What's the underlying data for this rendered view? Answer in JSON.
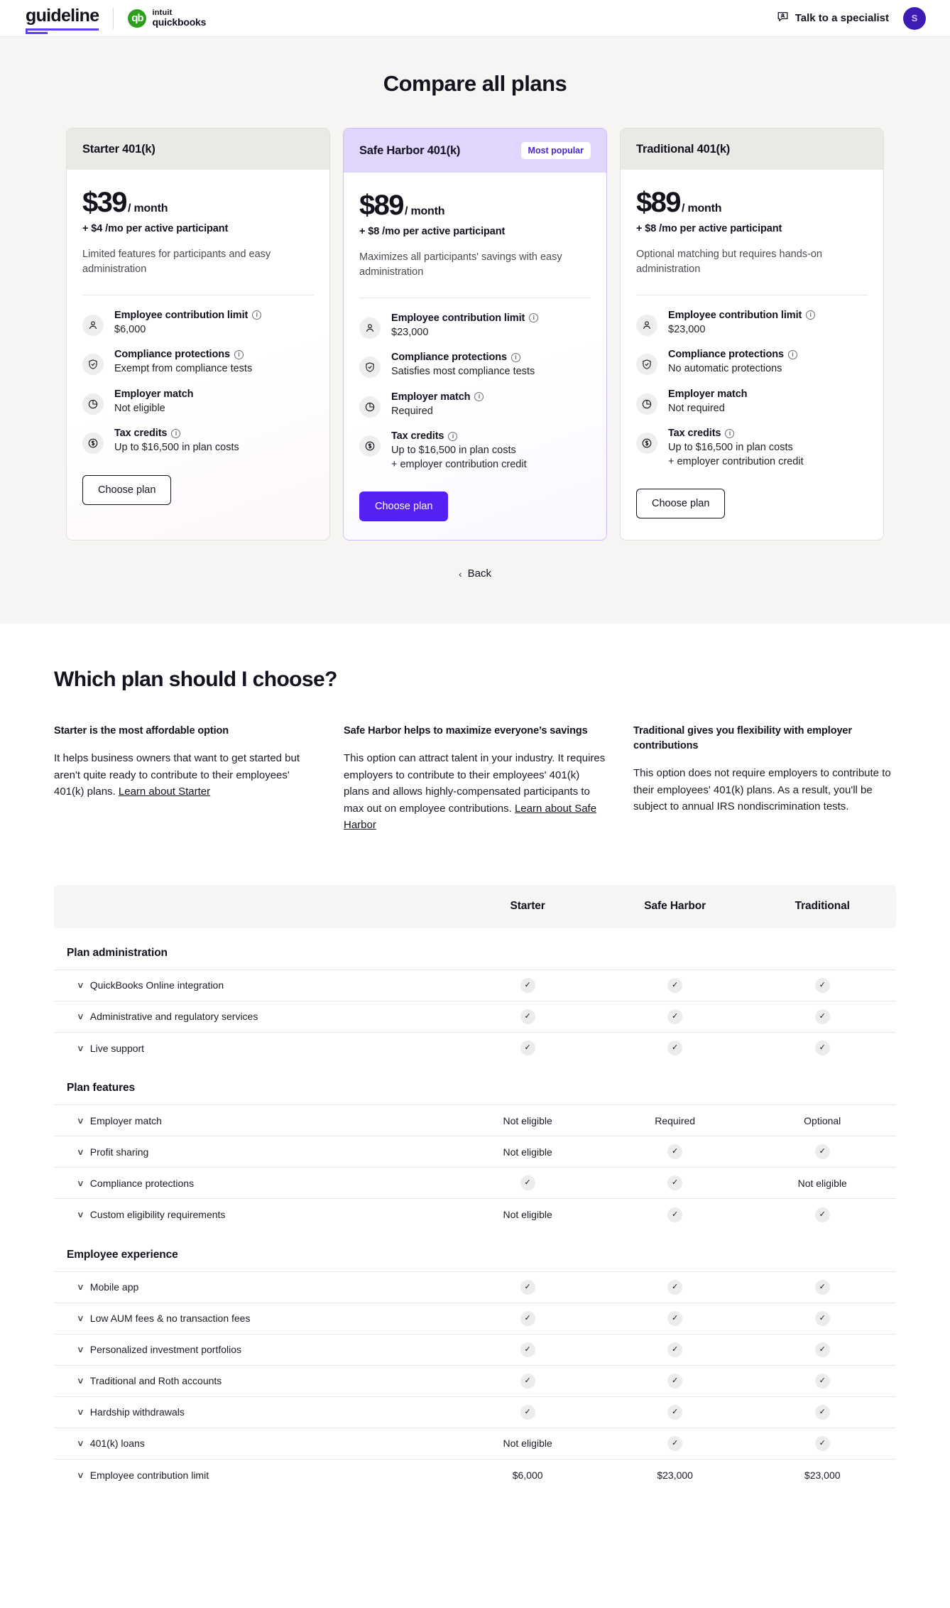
{
  "header": {
    "brand_guideline": "guideline",
    "brand_intuit": "intuit",
    "brand_quickbooks": "quickbooks",
    "qb_mark": "qb",
    "specialist_label": "Talk to a specialist",
    "avatar_initial": "S"
  },
  "compare": {
    "title": "Compare all plans",
    "back_label": "Back",
    "back_chevron": "‹",
    "cards": [
      {
        "name": "Starter 401(k)",
        "badge": "",
        "price": "$39",
        "price_unit": "/ month",
        "price_sub": "+ $4 /mo per active participant",
        "description": "Limited features for participants and easy administration",
        "cta": "Choose plan",
        "features": [
          {
            "icon": "person-icon",
            "title": "Employee contribution limit",
            "info": true,
            "value": "$6,000"
          },
          {
            "icon": "shield-check-icon",
            "title": "Compliance protections",
            "info": true,
            "value": "Exempt from compliance tests"
          },
          {
            "icon": "pie-chart-icon",
            "title": "Employer match",
            "info": false,
            "value": "Not eligible"
          },
          {
            "icon": "dollar-circle-icon",
            "title": "Tax credits",
            "info": true,
            "value": "Up to $16,500 in plan costs"
          }
        ]
      },
      {
        "name": "Safe Harbor 401(k)",
        "badge": "Most popular",
        "price": "$89",
        "price_unit": "/ month",
        "price_sub": "+ $8 /mo per active participant",
        "description": "Maximizes all participants' savings with easy administration",
        "cta": "Choose plan",
        "features": [
          {
            "icon": "person-icon",
            "title": "Employee contribution limit",
            "info": true,
            "value": "$23,000"
          },
          {
            "icon": "shield-check-icon",
            "title": "Compliance protections",
            "info": true,
            "value": "Satisfies most compliance tests"
          },
          {
            "icon": "pie-chart-icon",
            "title": "Employer match",
            "info": true,
            "value": "Required"
          },
          {
            "icon": "dollar-circle-icon",
            "title": "Tax credits",
            "info": true,
            "value": "Up to $16,500 in plan costs\n+ employer contribution credit"
          }
        ]
      },
      {
        "name": "Traditional 401(k)",
        "badge": "",
        "price": "$89",
        "price_unit": "/ month",
        "price_sub": "+ $8 /mo per active participant",
        "description": "Optional matching but requires hands-on administration",
        "cta": "Choose plan",
        "features": [
          {
            "icon": "person-icon",
            "title": "Employee contribution limit",
            "info": true,
            "value": "$23,000"
          },
          {
            "icon": "shield-check-icon",
            "title": "Compliance protections",
            "info": true,
            "value": "No automatic protections"
          },
          {
            "icon": "pie-chart-icon",
            "title": "Employer match",
            "info": false,
            "value": "Not required"
          },
          {
            "icon": "dollar-circle-icon",
            "title": "Tax credits",
            "info": true,
            "value": "Up to $16,500 in plan costs\n+ employer contribution credit"
          }
        ]
      }
    ]
  },
  "which_plan": {
    "title": "Which plan should I choose?",
    "columns": [
      {
        "heading": "Starter is the most affordable option",
        "body": "It helps business owners that want to get started but aren't quite ready to contribute to their employees' 401(k) plans. ",
        "link": "Learn about Starter"
      },
      {
        "heading": "Safe Harbor helps to maximize everyone’s savings",
        "body": "This option can attract talent in your industry. It requires employers to contribute to their employees' 401(k) plans and allows highly-compensated participants to max out on employee contributions. ",
        "link": "Learn about Safe Harbor"
      },
      {
        "heading": "Traditional gives you flexibility with employer contributions",
        "body": "This option does not require employers to contribute to their employees' 401(k) plans. As a result, you'll be subject to annual IRS nondiscrimination tests.",
        "link": ""
      }
    ]
  },
  "comparison_table": {
    "columns": [
      "",
      "Starter",
      "Safe Harbor",
      "Traditional"
    ],
    "chevron": "∨",
    "check_glyph": "✓",
    "groups": [
      {
        "name": "Plan administration",
        "rows": [
          {
            "feature": "QuickBooks Online integration",
            "starter": "check",
            "safe_harbor": "check",
            "traditional": "check"
          },
          {
            "feature": "Administrative and regulatory services",
            "starter": "check",
            "safe_harbor": "check",
            "traditional": "check"
          },
          {
            "feature": "Live support",
            "starter": "check",
            "safe_harbor": "check",
            "traditional": "check"
          }
        ]
      },
      {
        "name": "Plan features",
        "rows": [
          {
            "feature": "Employer match",
            "starter": "Not eligible",
            "safe_harbor": "Required",
            "traditional": "Optional"
          },
          {
            "feature": "Profit sharing",
            "starter": "Not eligible",
            "safe_harbor": "check",
            "traditional": "check"
          },
          {
            "feature": "Compliance protections",
            "starter": "check",
            "safe_harbor": "check",
            "traditional": "Not eligible"
          },
          {
            "feature": "Custom eligibility requirements",
            "starter": "Not eligible",
            "safe_harbor": "check",
            "traditional": "check"
          }
        ]
      },
      {
        "name": "Employee experience",
        "rows": [
          {
            "feature": "Mobile app",
            "starter": "check",
            "safe_harbor": "check",
            "traditional": "check"
          },
          {
            "feature": "Low AUM fees & no transaction fees",
            "starter": "check",
            "safe_harbor": "check",
            "traditional": "check"
          },
          {
            "feature": "Personalized investment portfolios",
            "starter": "check",
            "safe_harbor": "check",
            "traditional": "check"
          },
          {
            "feature": "Traditional and Roth accounts",
            "starter": "check",
            "safe_harbor": "check",
            "traditional": "check"
          },
          {
            "feature": "Hardship withdrawals",
            "starter": "check",
            "safe_harbor": "check",
            "traditional": "check"
          },
          {
            "feature": "401(k) loans",
            "starter": "Not eligible",
            "safe_harbor": "check",
            "traditional": "check"
          },
          {
            "feature": "Employee contribution limit",
            "starter": "$6,000",
            "safe_harbor": "$23,000",
            "traditional": "$23,000"
          }
        ]
      }
    ]
  },
  "colors": {
    "accent_purple": "#5521f2",
    "badge_text": "#4b23d6",
    "featured_header": "#dfd5fd",
    "section_bg": "#f6f5f3",
    "qb_green": "#2ca01c",
    "avatar_bg": "#3d1cb3"
  }
}
